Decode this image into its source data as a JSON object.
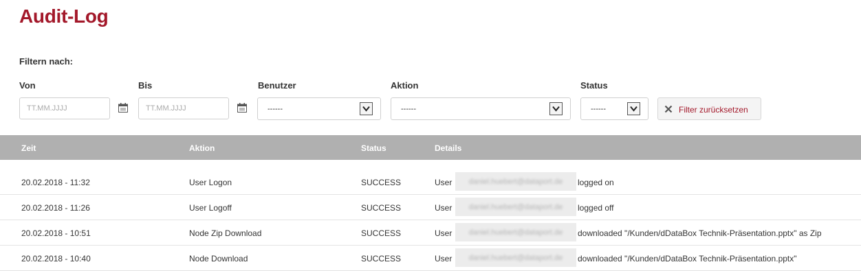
{
  "page": {
    "title": "Audit-Log"
  },
  "filters": {
    "heading": "Filtern nach:",
    "von": {
      "label": "Von",
      "placeholder": "TT.MM.JJJJ"
    },
    "bis": {
      "label": "Bis",
      "placeholder": "TT.MM.JJJJ"
    },
    "benutzer": {
      "label": "Benutzer",
      "value": "------"
    },
    "aktion": {
      "label": "Aktion",
      "value": "------"
    },
    "status": {
      "label": "Status",
      "value": "------"
    },
    "reset_label": "Filter zurücksetzen"
  },
  "table": {
    "headers": {
      "zeit": "Zeit",
      "aktion": "Aktion",
      "status": "Status",
      "details": "Details"
    },
    "rows": [
      {
        "zeit": "20.02.2018 - 11:32",
        "aktion": "User Logon",
        "status": "SUCCESS",
        "details_prefix": "User",
        "user": "daniel.huebert@dataport.de",
        "details_suffix": "logged on"
      },
      {
        "zeit": "20.02.2018 - 11:26",
        "aktion": "User Logoff",
        "status": "SUCCESS",
        "details_prefix": "User",
        "user": "daniel.huebert@dataport.de",
        "details_suffix": "logged off"
      },
      {
        "zeit": "20.02.2018 - 10:51",
        "aktion": "Node Zip Download",
        "status": "SUCCESS",
        "details_prefix": "User",
        "user": "daniel.huebert@dataport.de",
        "details_suffix": "downloaded \"/Kunden/dDataBox Technik-Präsentation.pptx\" as Zip"
      },
      {
        "zeit": "20.02.2018 - 10:40",
        "aktion": "Node Download",
        "status": "SUCCESS",
        "details_prefix": "User",
        "user": "daniel.huebert@dataport.de",
        "details_suffix": "downloaded \"/Kunden/dDataBox Technik-Präsentation.pptx\""
      }
    ]
  },
  "colors": {
    "brand": "#a3182a",
    "header_bg": "#b0b0b0"
  },
  "icons": {
    "calendar": "calendar-icon",
    "dropdown": "chevron-down-icon",
    "reset": "close-icon"
  }
}
